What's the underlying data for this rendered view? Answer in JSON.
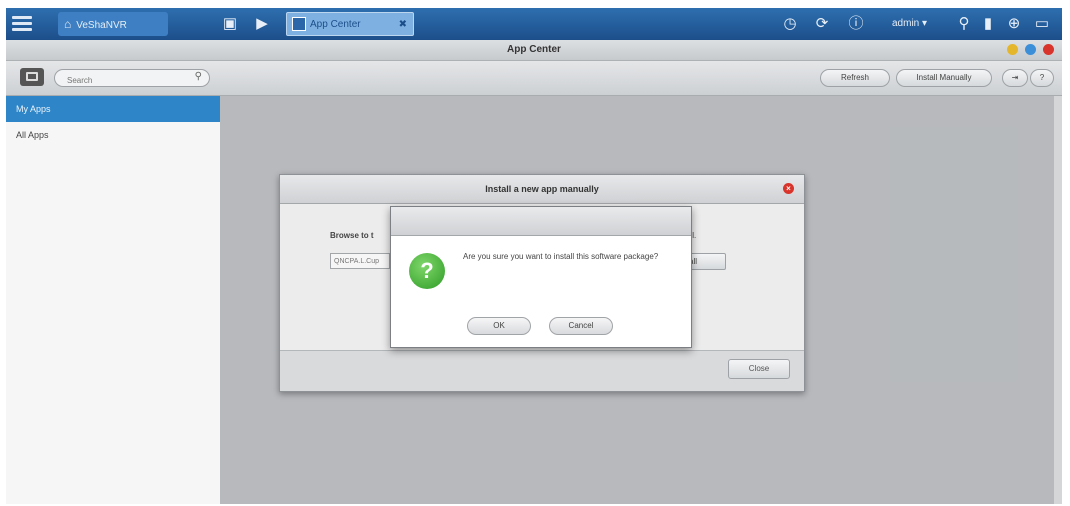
{
  "taskbar": {
    "home_label": "VeShaNVR",
    "tab_label": "App Center",
    "user_label": "admin ▾",
    "icons": [
      "menu-icon",
      "home-icon",
      "monitor-icon",
      "play-icon",
      "app-center-icon",
      "clock-icon",
      "sync-icon",
      "info-icon",
      "search-icon",
      "storage-icon",
      "network-icon",
      "chat-icon"
    ]
  },
  "window": {
    "title": "App Center",
    "controls_colors": [
      "#e4b62b",
      "#3b8fd9",
      "#d9342b"
    ]
  },
  "toolbar": {
    "search_placeholder": "Search",
    "refresh_label": "Refresh",
    "install_manually_label": "Install Manually"
  },
  "sidebar": {
    "items": [
      {
        "label": "My Apps",
        "active": true
      },
      {
        "label": "All Apps",
        "active": false
      }
    ]
  },
  "install_dialog": {
    "title": "Install a new app manually",
    "browse_label": "Browse to t",
    "browse_right_label": "all.",
    "field_value": "QNCPA.L.Cup",
    "browse_button": "all",
    "close_button": "Close"
  },
  "confirm_dialog": {
    "message": "Are you sure you want to install this software package?",
    "ok_label": "OK",
    "cancel_label": "Cancel"
  }
}
